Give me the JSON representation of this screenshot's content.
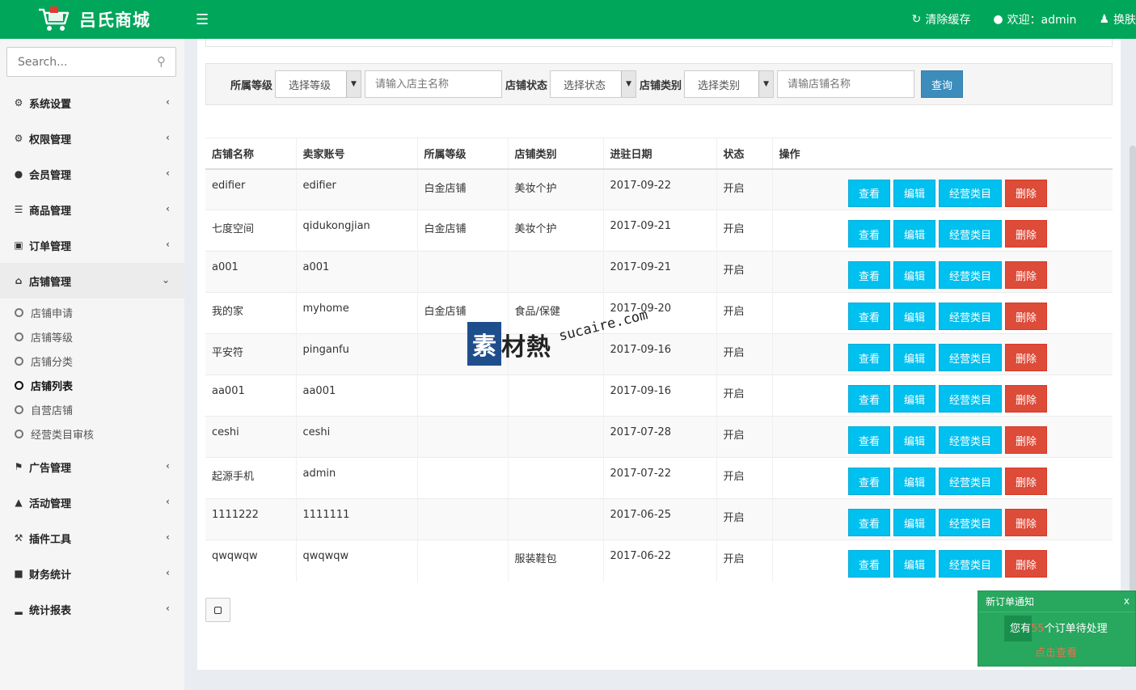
{
  "header": {
    "app_title": "吕氏商城",
    "clear_cache": "清除缓存",
    "welcome": "欢迎：admin",
    "skin": "换肤"
  },
  "sidebar": {
    "search_placeholder": "Search...",
    "menus": [
      {
        "label": "系统设置",
        "icon": "gear-icon"
      },
      {
        "label": "权限管理",
        "icon": "gears-icon"
      },
      {
        "label": "会员管理",
        "icon": "user-icon"
      },
      {
        "label": "商品管理",
        "icon": "list-icon"
      },
      {
        "label": "订单管理",
        "icon": "money-icon"
      },
      {
        "label": "店铺管理",
        "icon": "home-icon"
      },
      {
        "label": "广告管理",
        "icon": "flag-icon"
      },
      {
        "label": "活动管理",
        "icon": "bell-icon"
      },
      {
        "label": "插件工具",
        "icon": "wrench-icon"
      },
      {
        "label": "财务统计",
        "icon": "book-icon"
      },
      {
        "label": "统计报表",
        "icon": "signal-icon"
      }
    ],
    "shop_submenu": [
      "店铺申请",
      "店铺等级",
      "店铺分类",
      "店铺列表",
      "自营店铺",
      "经营类目审核"
    ]
  },
  "filters": {
    "level_label": "所属等级",
    "level_value": "选择等级",
    "owner_placeholder": "请输入店主名称",
    "status_label": "店铺状态",
    "status_value": "选择状态",
    "type_label": "店铺类别",
    "type_value": "选择类别",
    "shop_placeholder": "请输店铺名称",
    "query_button": "查询"
  },
  "table": {
    "headers": [
      "店铺名称",
      "卖家账号",
      "所属等级",
      "店铺类别",
      "进驻日期",
      "状态",
      "操作"
    ],
    "rows": [
      [
        "edifier",
        "edifier",
        "白金店铺",
        "美妆个护",
        "2017-09-22",
        "开启"
      ],
      [
        "七度空间",
        "qidukongjian",
        "白金店铺",
        "美妆个护",
        "2017-09-21",
        "开启"
      ],
      [
        "a001",
        "a001",
        "",
        "",
        "2017-09-21",
        "开启"
      ],
      [
        "我的家",
        "myhome",
        "白金店铺",
        "食品/保健",
        "2017-09-20",
        "开启"
      ],
      [
        "平安符",
        "pinganfu",
        "",
        "",
        "2017-09-16",
        "开启"
      ],
      [
        "aa001",
        "aa001",
        "",
        "",
        "2017-09-16",
        "开启"
      ],
      [
        "ceshi",
        "ceshi",
        "",
        "",
        "2017-07-28",
        "开启"
      ],
      [
        "起源手机",
        "admin",
        "",
        "",
        "2017-07-22",
        "开启"
      ],
      [
        "1111222",
        "1111111",
        "",
        "",
        "2017-06-25",
        "开启"
      ],
      [
        "qwqwqw",
        "qwqwqw",
        "",
        "服装鞋包",
        "2017-06-22",
        "开启"
      ]
    ],
    "actions": {
      "view": "查看",
      "edit": "编辑",
      "category": "经营类目",
      "delete": "删除"
    }
  },
  "notification": {
    "title": "新订单通知",
    "close": "x",
    "msg_prefix": "您有",
    "count": "55",
    "msg_suffix": "个订单待处理",
    "link": "点击查看"
  },
  "watermark": {
    "box_char": "素",
    "cn": "材熱",
    "en": "sucaire.com"
  },
  "colors": {
    "header_green": "#00a65a",
    "info_button": "#00c0ef",
    "danger_button": "#dd4b39",
    "primary_button": "#3c8dbc"
  }
}
